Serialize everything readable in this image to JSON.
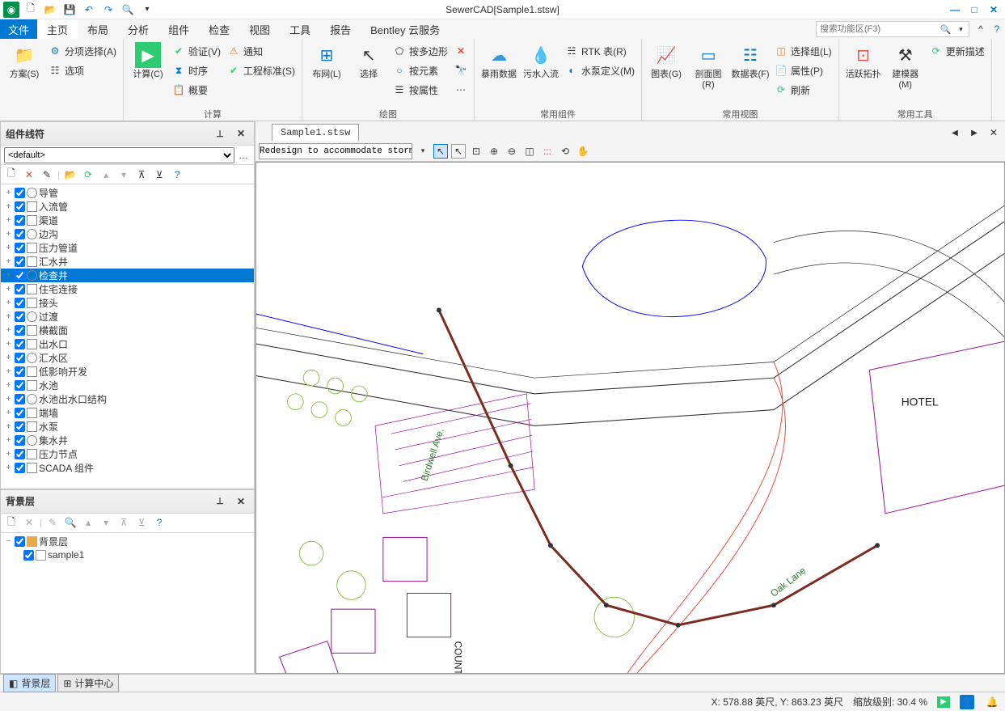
{
  "title": "SewerCAD[Sample1.stsw]",
  "search_placeholder": "搜索功能区(F3)",
  "tabs": {
    "file": "文件",
    "items": [
      "主页",
      "布局",
      "分析",
      "组件",
      "检查",
      "视图",
      "工具",
      "报告",
      "Bentley 云服务"
    ]
  },
  "ribbon": {
    "group0": {
      "scheme": "方案(S)",
      "partialSelect": "分项选择(A)",
      "options": "选项",
      "title": ""
    },
    "group_calc": {
      "calc": "计算(C)",
      "verify": "验证(V)",
      "notify": "通知",
      "timeseq": "时序",
      "std": "工程标准(S)",
      "summary": "概要",
      "title": "计算"
    },
    "group_draw": {
      "layout": "布网(L)",
      "select": "选择",
      "by_poly": "按多边形",
      "by_elem": "按元素",
      "by_attr": "按属性",
      "title": "绘图"
    },
    "group_common": {
      "storm": "暴雨数据",
      "inflow": "污水入流",
      "rtk": "RTK 表(R)",
      "pump": "水泵定义(M)",
      "title": "常用组件"
    },
    "group_view": {
      "chart": "图表(G)",
      "profile": "剖面图(R)",
      "datatable": "数据表(F)",
      "selset": "选择组(L)",
      "attrs": "属性(P)",
      "refresh": "刷新",
      "title": "常用视图"
    },
    "group_tools": {
      "activeTopo": "活跃拓扑",
      "modeler": "建模器(M)",
      "updateDesc": "更新描述",
      "title": "常用工具"
    }
  },
  "panel_symbols": {
    "title": "组件线符",
    "default_option": "<default>",
    "items": [
      "导管",
      "入流管",
      "渠道",
      "边沟",
      "压力管道",
      "汇水井",
      "检查井",
      "住宅连接",
      "接头",
      "过渡",
      "横截面",
      "出水口",
      "汇水区",
      "低影响开发",
      "水池",
      "水池出水口结构",
      "端墙",
      "水泵",
      "集水井",
      "压力节点",
      "SCADA 组件"
    ],
    "selected_index": 6
  },
  "panel_bglayers": {
    "title": "背景层",
    "root": "背景层",
    "children": [
      "sample1"
    ]
  },
  "doc_tab": "Sample1.stsw",
  "scenario": "Redesign to accommodate storm,",
  "map_labels": {
    "hotel": "HOTEL",
    "birdwell": "Birdwell Ave.",
    "oak": "Oak Lane",
    "country": "COUNTRY"
  },
  "bottom_tabs": [
    "背景层",
    "计算中心"
  ],
  "status": {
    "coords": "X: 578.88 英尺, Y: 863.23 英尺",
    "zoom": "缩放级别: 30.4 %"
  }
}
